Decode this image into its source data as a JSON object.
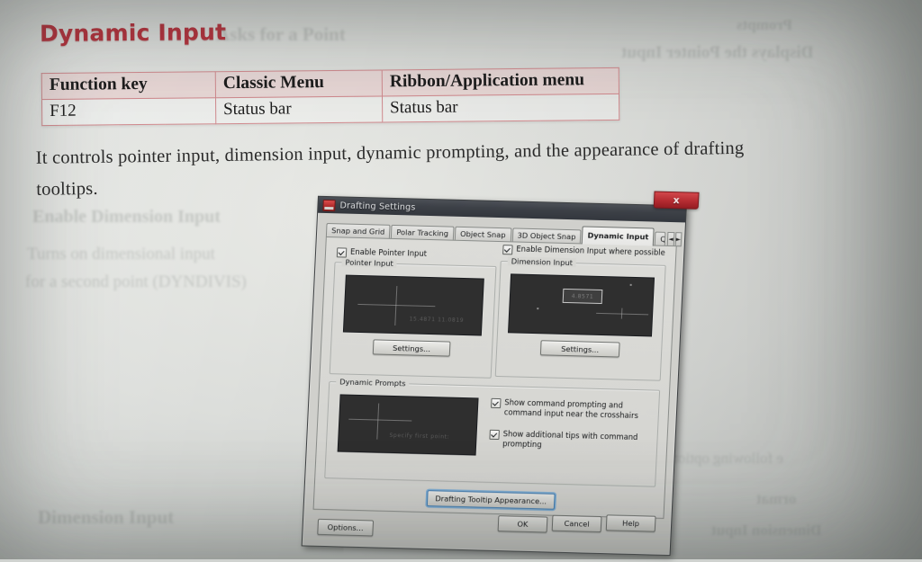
{
  "page": {
    "headline": "Dynamic Input",
    "table": {
      "headers": [
        "Function key",
        "Classic Menu",
        "Ribbon/Application menu"
      ],
      "rows": [
        [
          "F12",
          "Status bar",
          "Status bar"
        ]
      ]
    },
    "paragraph_line1": "It controls pointer input, dimension input, dynamic prompting, and the appearance of drafting",
    "paragraph_line2": "tooltips.",
    "bleed_through": [
      "Asks for a Point",
      "Enable Dimension Input",
      "Turns on dimensional input",
      "for a second point (DYNDIVIS)",
      "Dimension Input",
      "e following options are d",
      "ormat",
      "Dimension Input",
      "Displays the Pointer Input",
      "Prompts"
    ]
  },
  "dialog": {
    "title": "Drafting Settings",
    "close_label": "x",
    "tabs": [
      {
        "label": "Snap and Grid",
        "active": false
      },
      {
        "label": "Polar Tracking",
        "active": false
      },
      {
        "label": "Object Snap",
        "active": false
      },
      {
        "label": "3D Object Snap",
        "active": false
      },
      {
        "label": "Dynamic Input",
        "active": true
      },
      {
        "label": "Quick Properties",
        "active": false
      }
    ],
    "scroll_left": "◄",
    "scroll_right": "►",
    "pointer": {
      "checkbox_label": "Enable Pointer Input",
      "group_label": "Pointer Input",
      "preview_text": "15.4871  11.0819",
      "settings_button": "Settings..."
    },
    "dimension": {
      "checkbox_label": "Enable Dimension Input where possible",
      "group_label": "Dimension Input",
      "preview_value": "4.8571",
      "settings_button": "Settings..."
    },
    "prompts": {
      "group_label": "Dynamic Prompts",
      "preview_text": "Specify first point:",
      "checkbox1_line1": "Show command prompting and",
      "checkbox1_line2": "command input near the crosshairs",
      "checkbox2_line1": "Show additional tips with command",
      "checkbox2_line2": "prompting"
    },
    "tooltip_appearance_button": "Drafting Tooltip Appearance...",
    "options_button": "Options...",
    "ok_button": "OK",
    "cancel_button": "Cancel",
    "help_button": "Help"
  },
  "colors": {
    "headline": "#b8313c",
    "table_border": "#d08a8e",
    "titlebar": "#393d44",
    "close": "#b9272d"
  }
}
